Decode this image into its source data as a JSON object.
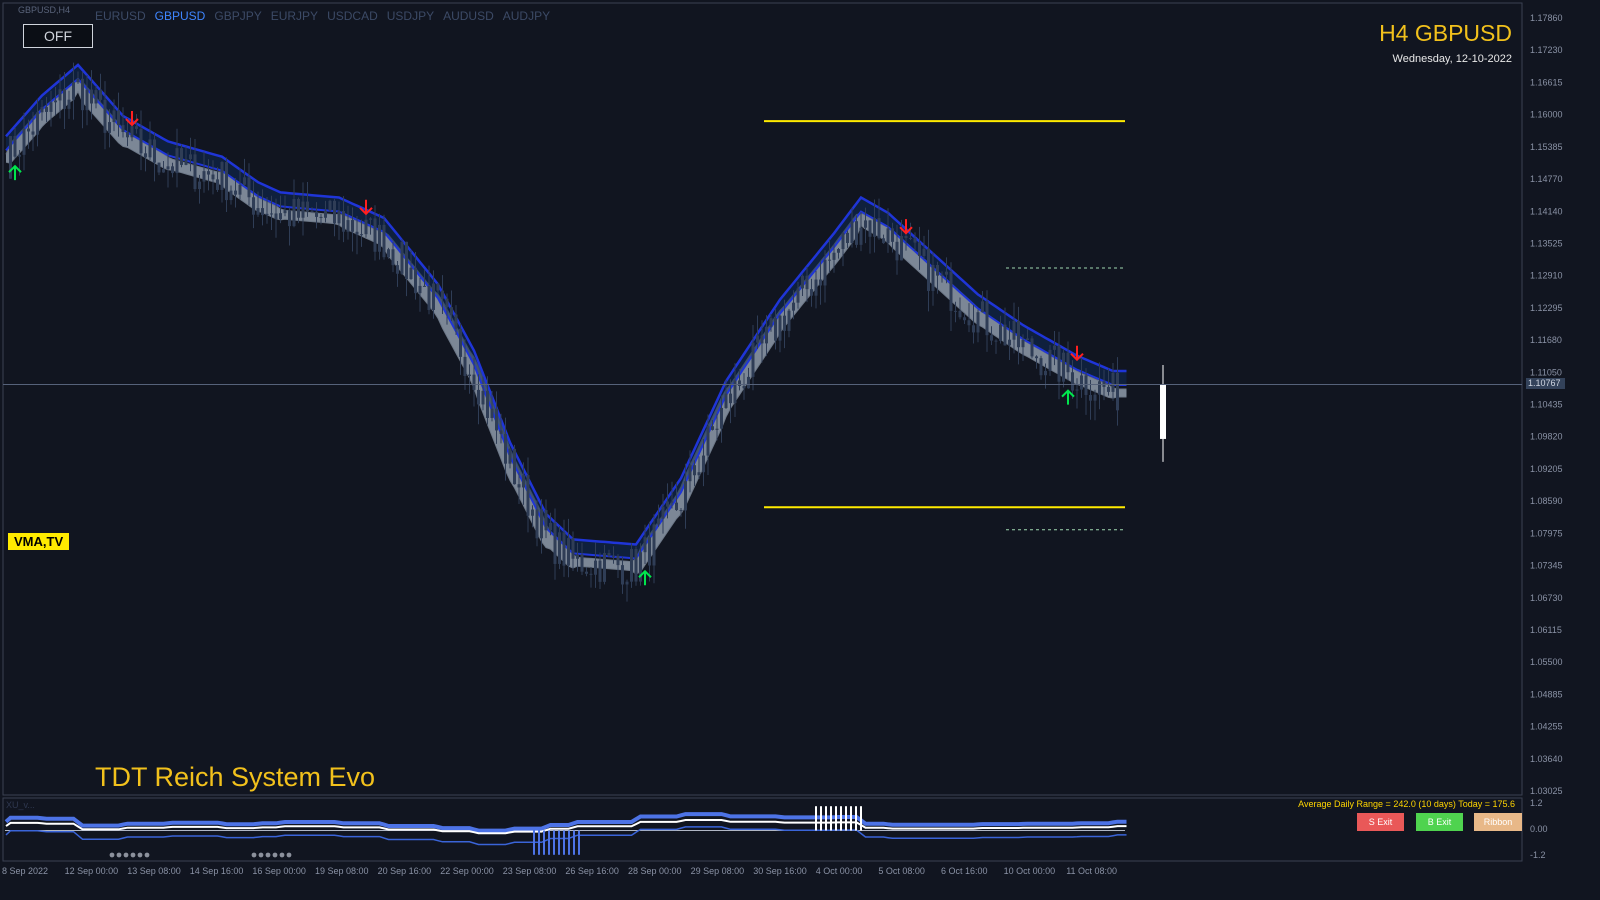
{
  "window_label": "GBPUSD,H4",
  "symbol_tabs": [
    "EURUSD",
    "GBPUSD",
    "GBPJPY",
    "EURJPY",
    "USDCAD",
    "USDJPY",
    "AUDUSD",
    "AUDJPY"
  ],
  "active_symbol": "GBPUSD",
  "off_button": "OFF",
  "header": {
    "title": "H4 GBPUSD",
    "date": "Wednesday, 12-10-2022"
  },
  "vma_label": "VMA,TV",
  "system_title": "TDT Reich System Evo",
  "adr_text": "Average Daily Range = 242.0 (10 days)   Today = 175.6",
  "buttons": {
    "s_exit": "S Exit",
    "b_exit": "B Exit",
    "ribbon": "Ribbon"
  },
  "current_price": "1.10767",
  "sub_window_label": "XU_v...",
  "price_axis": [
    "1.17860",
    "1.17230",
    "1.16615",
    "1.16000",
    "1.15385",
    "1.14770",
    "1.14140",
    "1.13525",
    "1.12910",
    "1.12295",
    "1.11680",
    "1.11050",
    "1.10435",
    "1.09820",
    "1.09205",
    "1.08590",
    "1.07975",
    "1.07345",
    "1.06730",
    "1.06115",
    "1.05500",
    "1.04885",
    "1.04255",
    "1.03640",
    "1.03025"
  ],
  "sub_axis": [
    "1.2",
    "0.00",
    "-1.2"
  ],
  "time_axis": [
    "8 Sep 2022",
    "12 Sep 00:00",
    "13 Sep 08:00",
    "14 Sep 16:00",
    "16 Sep 00:00",
    "19 Sep 08:00",
    "20 Sep 16:00",
    "22 Sep 00:00",
    "23 Sep 08:00",
    "26 Sep 16:00",
    "28 Sep 00:00",
    "29 Sep 08:00",
    "30 Sep 16:00",
    "4 Oct 00:00",
    "5 Oct 08:00",
    "6 Oct 16:00",
    "10 Oct 00:00",
    "11 Oct 08:00"
  ],
  "colors": {
    "background": "#111520",
    "ribbon_fill": "#8f9bab",
    "band_line": "#1f35d8",
    "band_fill": "#0f2a55",
    "candle": "#2f3d56",
    "buy_arrow": "#00e64d",
    "sell_arrow": "#ff2020",
    "level_line": "#ffeb00",
    "title": "#f2c11c"
  },
  "icons": {
    "buy_signal": "arrow-up-icon",
    "sell_signal": "arrow-down-icon"
  },
  "chart_data": {
    "type": "candlestick",
    "symbol": "GBPUSD",
    "timeframe": "H4",
    "ylim": [
      1.028,
      1.1795
    ],
    "baseline_path": [
      [
        0,
        1.152
      ],
      [
        8,
        1.16
      ],
      [
        16,
        1.166
      ],
      [
        21,
        1.161
      ],
      [
        26,
        1.156
      ],
      [
        36,
        1.151
      ],
      [
        48,
        1.148
      ],
      [
        56,
        1.143
      ],
      [
        61,
        1.141
      ],
      [
        74,
        1.14
      ],
      [
        84,
        1.136
      ],
      [
        96,
        1.123
      ],
      [
        104,
        1.11
      ],
      [
        112,
        1.092
      ],
      [
        120,
        1.078
      ],
      [
        126,
        1.073
      ],
      [
        140,
        1.072
      ],
      [
        150,
        1.085
      ],
      [
        160,
        1.104
      ],
      [
        172,
        1.12
      ],
      [
        184,
        1.133
      ],
      [
        190,
        1.14
      ],
      [
        196,
        1.137
      ],
      [
        206,
        1.129
      ],
      [
        216,
        1.121
      ],
      [
        226,
        1.115
      ],
      [
        238,
        1.109
      ],
      [
        246,
        1.106
      ]
    ],
    "buy_signals": [
      2,
      142,
      236
    ],
    "sell_signals": [
      28,
      80,
      200,
      238
    ],
    "levels": [
      {
        "value": 1.1593,
        "style": "solid"
      },
      {
        "value": 1.0836,
        "style": "solid"
      },
      {
        "value": 1.1305,
        "style": "dotted"
      },
      {
        "value": 1.0792,
        "style": "dotted"
      }
    ],
    "current_price": 1.10767,
    "sub_window_ylim": [
      -1.2,
      1.2
    ]
  }
}
